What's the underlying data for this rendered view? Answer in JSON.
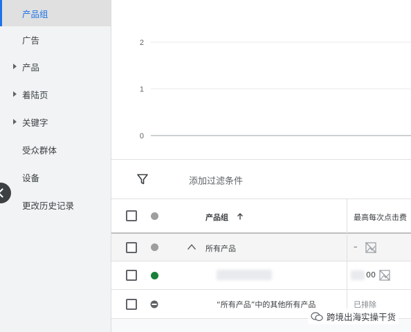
{
  "sidebar": {
    "items": [
      {
        "label": "产品组",
        "active": true,
        "expandable": false
      },
      {
        "label": "广告",
        "active": false,
        "expandable": false
      },
      {
        "label": "产品",
        "active": false,
        "expandable": true
      },
      {
        "label": "着陆页",
        "active": false,
        "expandable": true
      },
      {
        "label": "关键字",
        "active": false,
        "expandable": true
      },
      {
        "label": "受众群体",
        "active": false,
        "expandable": false
      },
      {
        "label": "设备",
        "active": false,
        "expandable": false
      },
      {
        "label": "更改历史记录",
        "active": false,
        "expandable": false
      }
    ]
  },
  "chart_data": {
    "type": "line",
    "yticks": [
      "2",
      "1",
      "0"
    ],
    "ylim": [
      0,
      2
    ],
    "series": [],
    "grid": true
  },
  "filter": {
    "label": "添加过滤条件"
  },
  "table": {
    "headers": {
      "product_group": "产品组",
      "max_cpc": "最高每次点击费"
    },
    "rows": [
      {
        "name": "所有产品",
        "status_color": "#9e9e9e",
        "bid": "–",
        "type": "group"
      },
      {
        "name": "",
        "status_color": "#188038",
        "bid": "00",
        "type": "blurred"
      },
      {
        "name": "“所有产品”中的其他所有产品",
        "status_color": "#5f6368",
        "bid": "已排除",
        "type": "excluded"
      }
    ]
  },
  "watermark": {
    "text": "跨境出海实操干货"
  },
  "colors": {
    "accent": "#1a73e8",
    "active_status": "#188038",
    "neutral_status": "#9e9e9e"
  }
}
